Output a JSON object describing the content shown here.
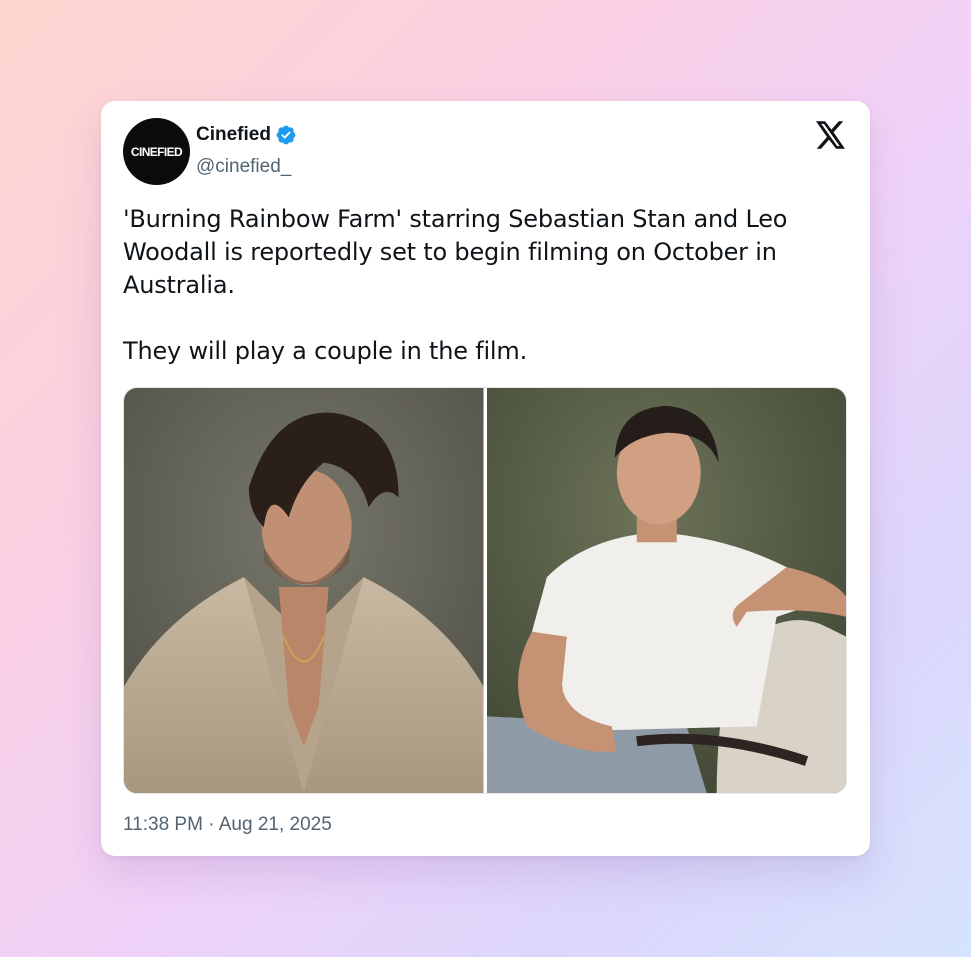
{
  "account": {
    "avatar_text": "CINEFIED",
    "display_name": "Cinefied",
    "handle": "@cinefied_",
    "verified": true
  },
  "platform_icon": "x-logo-icon",
  "tweet": {
    "text": "'Burning Rainbow Farm' starring Sebastian Stan and Leo Woodall is reportedly set to begin filming on October in Australia.\n\nThey will play a couple in the film.",
    "timestamp": "11:38 PM · Aug 21, 2025"
  },
  "media": [
    {
      "name": "photo-left"
    },
    {
      "name": "photo-right"
    }
  ],
  "colors": {
    "verified_blue": "#1d9bf0",
    "text_primary": "#0f1419",
    "text_secondary": "#536471"
  }
}
